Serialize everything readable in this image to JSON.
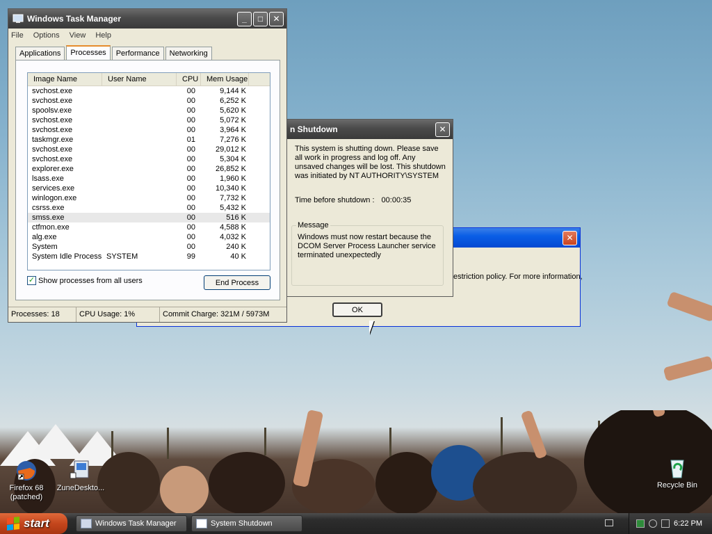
{
  "desktop": {
    "icons": [
      {
        "label": "Firefox 68 (patched)"
      },
      {
        "label": "ZuneDeskto..."
      },
      {
        "label": "Recycle Bin"
      }
    ]
  },
  "taskmgr": {
    "title": "Windows Task Manager",
    "menu": [
      "File",
      "Options",
      "View",
      "Help"
    ],
    "tabs": [
      "Applications",
      "Processes",
      "Performance",
      "Networking"
    ],
    "active_tab": "Processes",
    "columns": [
      "Image Name",
      "User Name",
      "CPU",
      "Mem Usage"
    ],
    "processes": [
      {
        "name": "svchost.exe",
        "user": "",
        "cpu": "00",
        "mem": "9,144 K"
      },
      {
        "name": "svchost.exe",
        "user": "",
        "cpu": "00",
        "mem": "6,252 K"
      },
      {
        "name": "spoolsv.exe",
        "user": "",
        "cpu": "00",
        "mem": "5,620 K"
      },
      {
        "name": "svchost.exe",
        "user": "",
        "cpu": "00",
        "mem": "5,072 K"
      },
      {
        "name": "svchost.exe",
        "user": "",
        "cpu": "00",
        "mem": "3,964 K"
      },
      {
        "name": "taskmgr.exe",
        "user": "",
        "cpu": "01",
        "mem": "7,276 K"
      },
      {
        "name": "svchost.exe",
        "user": "",
        "cpu": "00",
        "mem": "29,012 K"
      },
      {
        "name": "svchost.exe",
        "user": "",
        "cpu": "00",
        "mem": "5,304 K"
      },
      {
        "name": "explorer.exe",
        "user": "",
        "cpu": "00",
        "mem": "26,852 K"
      },
      {
        "name": "lsass.exe",
        "user": "",
        "cpu": "00",
        "mem": "1,960 K"
      },
      {
        "name": "services.exe",
        "user": "",
        "cpu": "00",
        "mem": "10,340 K"
      },
      {
        "name": "winlogon.exe",
        "user": "",
        "cpu": "00",
        "mem": "7,732 K"
      },
      {
        "name": "csrss.exe",
        "user": "",
        "cpu": "00",
        "mem": "5,432 K"
      },
      {
        "name": "smss.exe",
        "user": "",
        "cpu": "00",
        "mem": "516 K",
        "selected": true
      },
      {
        "name": "ctfmon.exe",
        "user": "",
        "cpu": "00",
        "mem": "4,588 K"
      },
      {
        "name": "alg.exe",
        "user": "",
        "cpu": "00",
        "mem": "4,032 K"
      },
      {
        "name": "System",
        "user": "",
        "cpu": "00",
        "mem": "240 K"
      },
      {
        "name": "System Idle Process",
        "user": "SYSTEM",
        "cpu": "99",
        "mem": "40 K"
      }
    ],
    "show_all_label": "Show processes from all users",
    "show_all_checked": true,
    "end_process_label": "End Process",
    "status": {
      "processes": "Processes: 18",
      "cpu": "CPU Usage: 1%",
      "commit": "Commit Charge: 321M / 5973M"
    }
  },
  "shutdown": {
    "title": "n Shutdown",
    "message": "This system is shutting down. Please save all work in progress and log off. Any unsaved changes will be lost. This shutdown was initiated by NT AUTHORITY\\SYSTEM",
    "countdown_label": "Time before shutdown :",
    "countdown_value": "00:00:35",
    "group_label": "Message",
    "group_message": "Windows must now restart because the DCOM Server Process Launcher service terminated unexpectedly",
    "ok_label": "OK"
  },
  "error_dialog": {
    "text": "estriction policy. For more information,"
  },
  "taskbar": {
    "start_label": "start",
    "items": [
      "Windows Task Manager",
      "System Shutdown"
    ],
    "clock": "6:22 PM"
  }
}
